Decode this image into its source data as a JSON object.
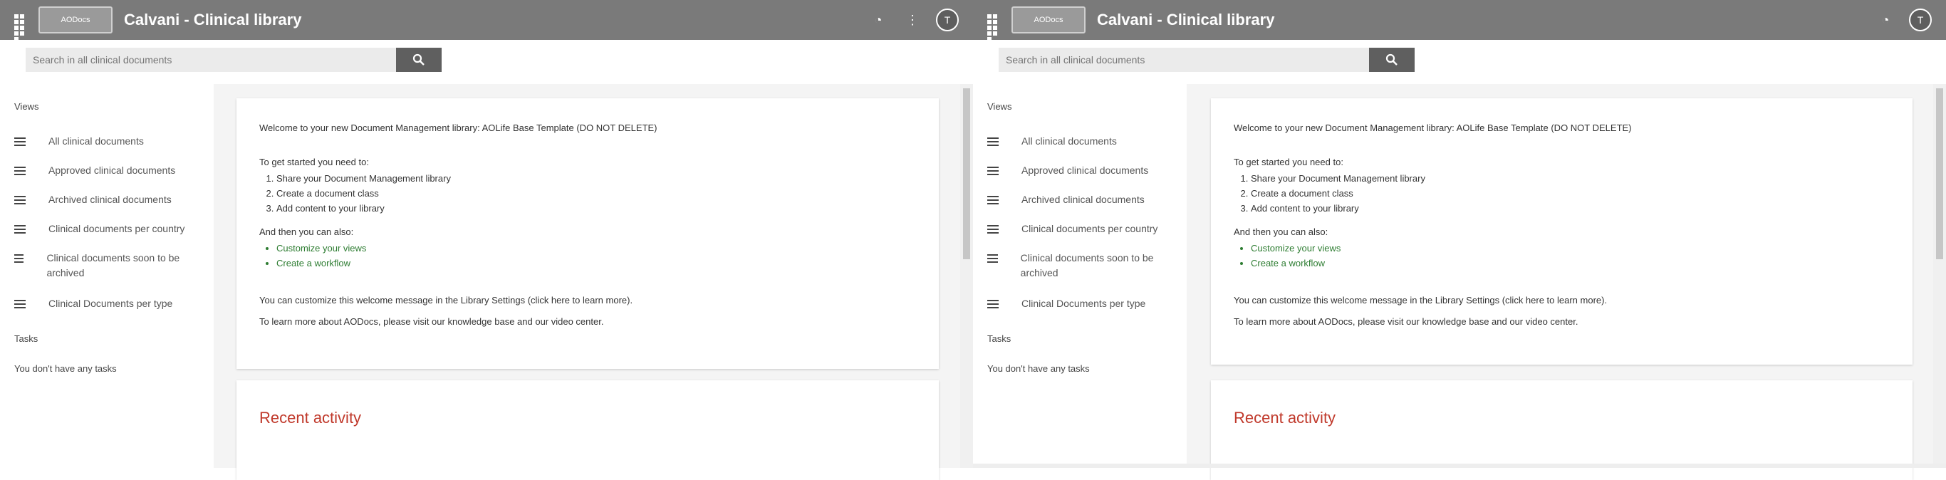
{
  "app": {
    "title": "Calvani - Clinical library",
    "logo_text": "AODocs",
    "user_initial": "T",
    "brand_color": "#7a7a7a"
  },
  "search": {
    "placeholder": "Search in all clinical documents",
    "icon": "search-icon"
  },
  "sidebar": {
    "views_label": "Views",
    "items": [
      {
        "label": "All clinical documents",
        "icon": "list-icon"
      },
      {
        "label": "Approved clinical documents",
        "icon": "list-icon"
      },
      {
        "label": "Archived clinical documents",
        "icon": "list-icon"
      },
      {
        "label": "Clinical documents per country",
        "icon": "list-icon"
      },
      {
        "label": "Clinical documents soon to be archived",
        "icon": "list-icon"
      },
      {
        "label": "Clinical Documents per type",
        "icon": "list-icon"
      }
    ],
    "tasks_label": "Tasks",
    "tasks_empty": "You don't have any tasks"
  },
  "welcome": {
    "intro": "Welcome to your new Document Management library: AOLife Base Template (DO NOT DELETE)",
    "get_started": "To get started you need to:",
    "steps": [
      "Share your Document Management library",
      "Create a document class",
      "Add content to your library"
    ],
    "then": "And then you can also:",
    "extras": [
      "Customize your views",
      "Create a workflow"
    ],
    "customize": "You can customize this welcome message in the Library Settings (click here to learn more).",
    "learn_more": "To learn more about AODocs, please visit our knowledge base and our video center."
  },
  "recent": {
    "heading": "Recent activity"
  }
}
